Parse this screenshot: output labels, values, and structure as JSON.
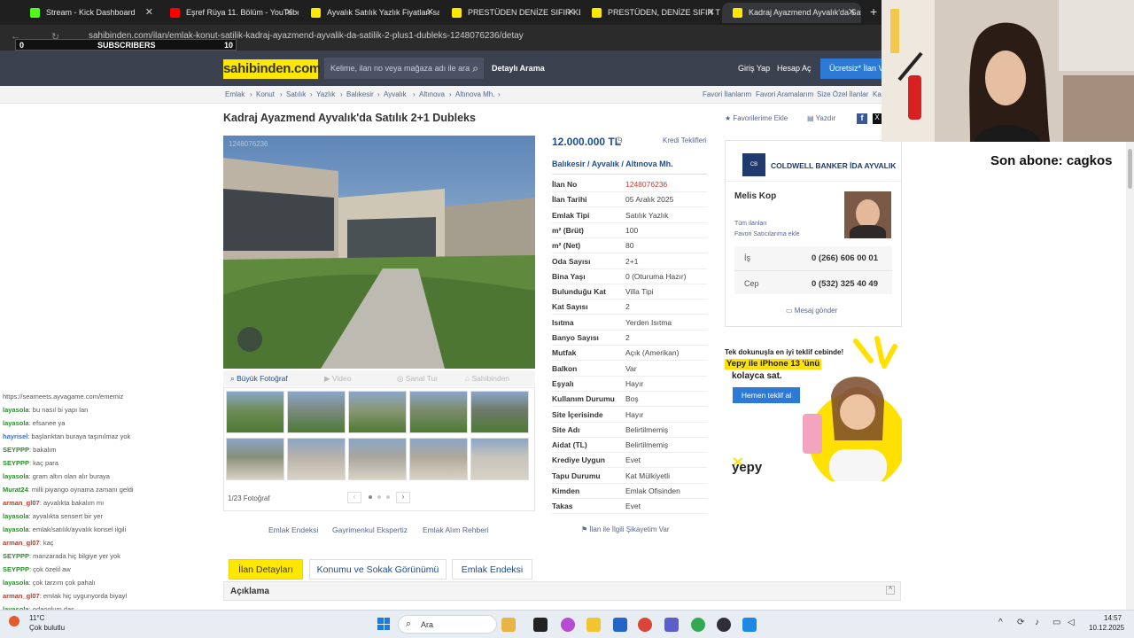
{
  "tabs": [
    {
      "label": "Stream - Kick Dashboard",
      "color": "#53fc18"
    },
    {
      "label": "Eşref Rüya 11. Bölüm - YouTube",
      "color": "#ff0000"
    },
    {
      "label": "Ayvalık Satılık Yazlık Fiyatları sa",
      "color": "#ffe800"
    },
    {
      "label": "PRESTÜDEN DENİZE SIFIR KENDİ",
      "color": "#ffe800"
    },
    {
      "label": "PRESTÜDEN, DENİZE SIFIR TÜZ",
      "color": "#ffe800"
    },
    {
      "label": "Kadraj Ayazmend Ayvalık'da Sat",
      "color": "#ffe800"
    }
  ],
  "address": {
    "url": "sahibinden.com/ilan/emlak-konut-satilik-kadraj-ayazmend-ayvalik-da-satilik-2-plus1-dubleks-1248076236/detay"
  },
  "overlay": {
    "subs_count": "0",
    "subs_label": "SUBSCRIBERS",
    "subs_goal": "10",
    "son_abone": "Son abone: cagkos"
  },
  "header": {
    "logo": "sahibinden.com",
    "search_placeholder": "Kelime, ilan no veya mağaza adı ile ara",
    "detayli": "Detaylı Arama",
    "giris": "Giriş Yap",
    "hesap": "Hesap Aç",
    "ucretsiz": "Ücretsiz* İlan Ver"
  },
  "breadcrumbs": [
    "Emlak",
    "Konut",
    "Satılık",
    "Yazlık",
    "Balıkesir",
    "Ayvalık",
    "Altınova",
    "Altınova Mh."
  ],
  "right_links": [
    "Favori İlanlarım",
    "Favori Aramalarım",
    "Size Özel İlanlar",
    "Karşılaştır"
  ],
  "title": "Kadraj Ayazmend Ayvalık'da Satılık 2+1 Dubleks",
  "title_links": {
    "fav": "Favorilerime Ekle",
    "print": "Yazdır"
  },
  "photo": {
    "watermark": "1248076236",
    "tools": [
      "Büyük Fotoğraf",
      "Video",
      "Sanal Tur",
      "Sahibinden"
    ],
    "counter": "1/23 Fotoğraf"
  },
  "listing": {
    "price": "12.000.000 TL",
    "kredi": "Kredi Teklifleri",
    "location": [
      "Balıkesir",
      "Ayvalık",
      "Altınova Mh."
    ],
    "details": [
      {
        "k": "İlan No",
        "v": "1248076236",
        "red": true
      },
      {
        "k": "İlan Tarihi",
        "v": "05 Aralık 2025"
      },
      {
        "k": "Emlak Tipi",
        "v": "Satılık Yazlık"
      },
      {
        "k": "m² (Brüt)",
        "v": "100"
      },
      {
        "k": "m² (Net)",
        "v": "80"
      },
      {
        "k": "Oda Sayısı",
        "v": "2+1"
      },
      {
        "k": "Bina Yaşı",
        "v": "0 (Oturuma Hazır)"
      },
      {
        "k": "Bulunduğu Kat",
        "v": "Villa Tipi"
      },
      {
        "k": "Kat Sayısı",
        "v": "2"
      },
      {
        "k": "Isıtma",
        "v": "Yerden Isıtma"
      },
      {
        "k": "Banyo Sayısı",
        "v": "2"
      },
      {
        "k": "Mutfak",
        "v": "Açık (Amerikan)"
      },
      {
        "k": "Balkon",
        "v": "Var"
      },
      {
        "k": "Eşyalı",
        "v": "Hayır"
      },
      {
        "k": "Kullanım Durumu",
        "v": "Boş"
      },
      {
        "k": "Site İçerisinde",
        "v": "Hayır"
      },
      {
        "k": "Site Adı",
        "v": "Belirtilmemiş"
      },
      {
        "k": "Aidat (TL)",
        "v": "Belirtilmemiş"
      },
      {
        "k": "Krediye Uygun",
        "v": "Evet"
      },
      {
        "k": "Tapu Durumu",
        "v": "Kat Mülkiyetli"
      },
      {
        "k": "Kimden",
        "v": "Emlak Ofisinden"
      },
      {
        "k": "Takas",
        "v": "Evet"
      }
    ]
  },
  "agent": {
    "office": "COLDWELL BANKER İDA AYVALIK",
    "name": "Melis Kop",
    "all_listings": "Tüm ilanları",
    "fav_seller": "Favori Satıcılarıma ekle",
    "is_label": "İş",
    "is_phone": "0 (266) 606 00 01",
    "cep_label": "Cep",
    "cep_phone": "0 (532) 325 40 49",
    "message": "Mesaj gönder"
  },
  "ad": {
    "line1": "Tek dokunuşla en iyi teklif cebinde!",
    "line2": "Yepy ile iPhone 13 'ünü",
    "line3": "kolayca sat.",
    "cta": "Hemen teklif al",
    "brand": "yepy"
  },
  "bottom_links": [
    "Emlak Endeksi",
    "Gayrimenkul Ekspertiz",
    "Emlak Alım Rehberi"
  ],
  "complaint": "İlan ile İlgili Şikayetim Var",
  "page_tabs": [
    "İlan Detayları",
    "Konumu ve Sokak Görünümü",
    "Emlak Endeksi"
  ],
  "aciklama": "Açıklama",
  "chat": [
    {
      "u": "",
      "t": "https://seameets.ayvagame.com/ememiz",
      "c": "#555"
    },
    {
      "u": "layasola",
      "t": ": bu nasıl bi yapı lan",
      "c": "#2e8b2e"
    },
    {
      "u": "layasola",
      "t": ": efsanee ya",
      "c": "#2e8b2e"
    },
    {
      "u": "hayriseİ",
      "t": ": başlarıktan buraya taşınılmaz yok",
      "c": "#3a6fd8"
    },
    {
      "u": "SEYPPP",
      "t": ": bakalım",
      "c": "#2e8b2e"
    },
    {
      "u": "SEYPPP",
      "t": ": kaç para",
      "c": "#2e8b2e"
    },
    {
      "u": "layasola",
      "t": ": gram altın olan alır buraya",
      "c": "#2e8b2e"
    },
    {
      "u": "Murat24",
      "t": ": milli piyango oynama zamanı geldi",
      "c": "#2e8b2e"
    },
    {
      "u": "arman_gl07",
      "t": ": ayvalıkta bakalım mı",
      "c": "#c0392b"
    },
    {
      "u": "layasola",
      "t": ": ayvalıkta sensert bir yer",
      "c": "#2e8b2e"
    },
    {
      "u": "layasola",
      "t": ": emlak/satılık/ayvalık konsel ilgili",
      "c": "#2e8b2e"
    },
    {
      "u": "arman_gl07",
      "t": ": kaç",
      "c": "#c0392b"
    },
    {
      "u": "SEYPPP",
      "t": ": manzarada hiç bilgiye yer yok",
      "c": "#2e8b2e"
    },
    {
      "u": "SEYPPP",
      "t": ": çok özelil aw",
      "c": "#2e8b2e"
    },
    {
      "u": "layasola",
      "t": ": çok tarzım çok pahalı",
      "c": "#2e8b2e"
    },
    {
      "u": "arman_gl07",
      "t": ": emlak hiç uygunyorda biyayl",
      "c": "#c0392b"
    },
    {
      "u": "layasola",
      "t": ": odaoglum.daş",
      "c": "#2e8b2e"
    }
  ],
  "taskbar": {
    "weather_temp": "11°C",
    "weather_text": "Çok bulutlu",
    "search": "Ara",
    "time": "14:57",
    "date": "10.12.2025"
  }
}
